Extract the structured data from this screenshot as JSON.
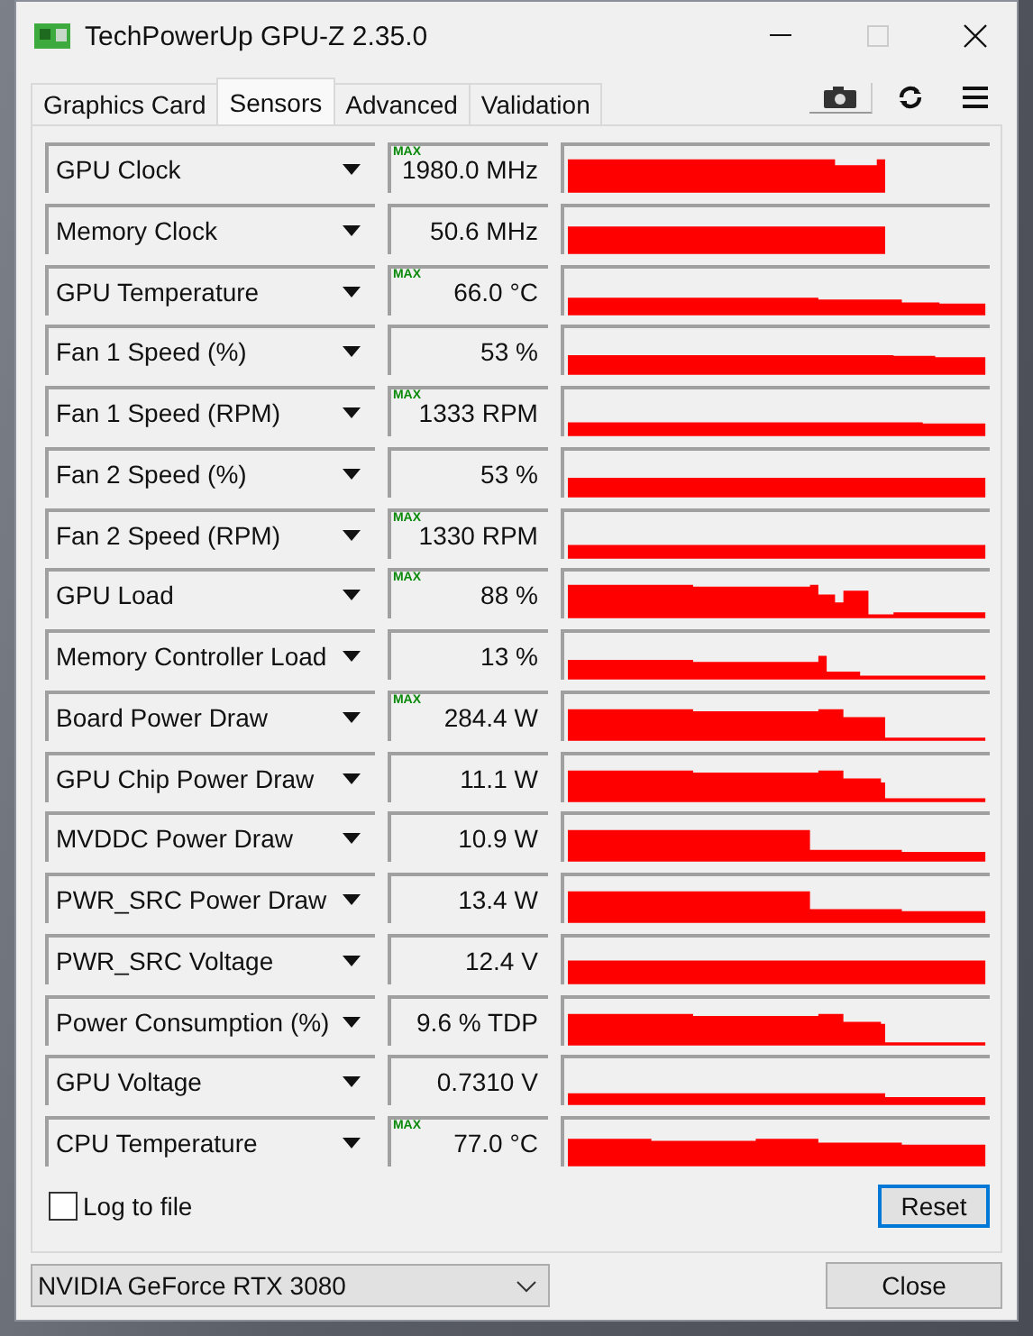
{
  "window": {
    "title": "TechPowerUp GPU-Z 2.35.0"
  },
  "tabs": [
    {
      "label": "Graphics Card",
      "selected": false
    },
    {
      "label": "Sensors",
      "selected": true
    },
    {
      "label": "Advanced",
      "selected": false
    },
    {
      "label": "Validation",
      "selected": false
    }
  ],
  "sensors": [
    {
      "name": "GPU Clock",
      "max_tag": "MAX",
      "value": "1980.0 MHz"
    },
    {
      "name": "Memory Clock",
      "value": "50.6 MHz"
    },
    {
      "name": "GPU Temperature",
      "max_tag": "MAX",
      "value": "66.0 °C"
    },
    {
      "name": "Fan 1 Speed (%)",
      "value": "53 %"
    },
    {
      "name": "Fan 1 Speed (RPM)",
      "max_tag": "MAX",
      "value": "1333 RPM"
    },
    {
      "name": "Fan 2 Speed (%)",
      "value": "53 %"
    },
    {
      "name": "Fan 2 Speed (RPM)",
      "max_tag": "MAX",
      "value": "1330 RPM"
    },
    {
      "name": "GPU Load",
      "max_tag": "MAX",
      "value": "88 %"
    },
    {
      "name": "Memory Controller Load",
      "value": "13 %"
    },
    {
      "name": "Board Power Draw",
      "max_tag": "MAX",
      "value": "284.4 W"
    },
    {
      "name": "GPU Chip Power Draw",
      "value": "11.1 W"
    },
    {
      "name": "MVDDC Power Draw",
      "value": "10.9 W"
    },
    {
      "name": "PWR_SRC Power Draw",
      "value": "13.4 W"
    },
    {
      "name": "PWR_SRC Voltage",
      "value": "12.4 V"
    },
    {
      "name": "Power Consumption (%)",
      "value": "9.6 % TDP"
    },
    {
      "name": "GPU Voltage",
      "value": "0.7310 V"
    },
    {
      "name": "CPU Temperature",
      "max_tag": "MAX",
      "value": "77.0 °C"
    }
  ],
  "log_to_file": {
    "label": "Log to file",
    "checked": false
  },
  "reset_button": "Reset",
  "device_select": {
    "value": "NVIDIA GeForce RTX 3080"
  },
  "close_button": "Close"
}
